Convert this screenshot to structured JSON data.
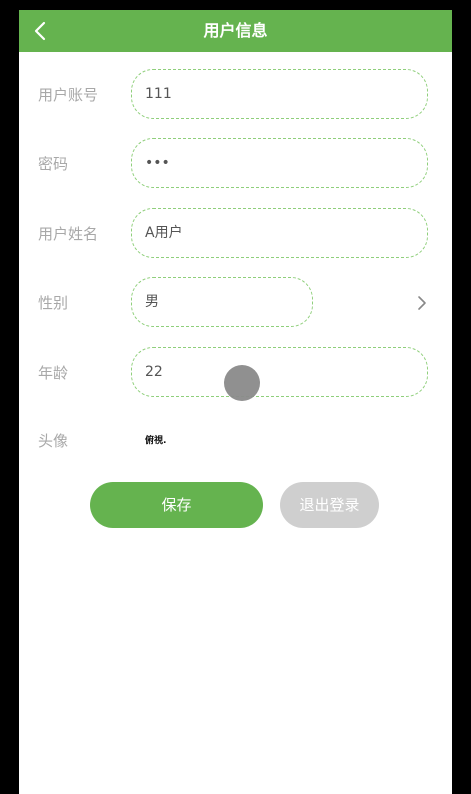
{
  "header": {
    "title": "用户信息"
  },
  "form": {
    "account": {
      "label": "用户账号",
      "value": "111"
    },
    "password": {
      "label": "密码",
      "value": "•••"
    },
    "name": {
      "label": "用户姓名",
      "value": "A用户"
    },
    "gender": {
      "label": "性别",
      "value": "男"
    },
    "age": {
      "label": "年龄",
      "value": "22"
    },
    "avatar": {
      "label": "头像",
      "value": "俯視."
    }
  },
  "actions": {
    "save_label": "保存",
    "logout_label": "退出登录"
  },
  "colors": {
    "accent": "#65b34f",
    "field_border": "#8fcf7b",
    "label": "#a8a8a8",
    "disabled_button": "#cfcfcf"
  },
  "icons": {
    "back": "chevron-left-icon",
    "gender_picker": "chevron-right-icon",
    "touch": "touch-indicator"
  }
}
